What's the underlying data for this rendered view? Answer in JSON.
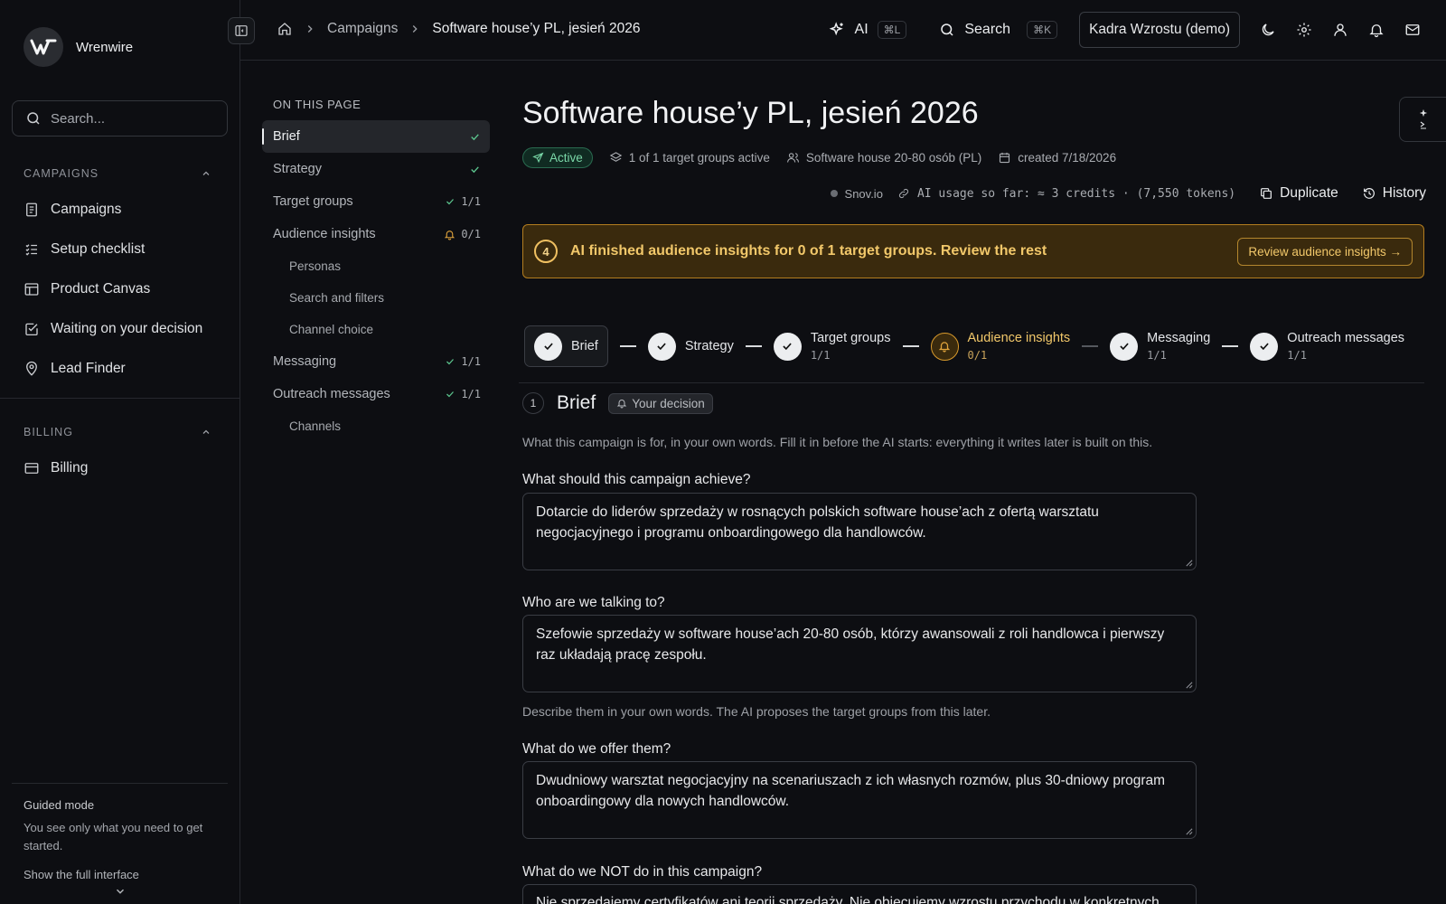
{
  "sidebar": {
    "brand": "Wrenwire",
    "search_placeholder": "Search...",
    "campaigns_header": "CAMPAIGNS",
    "items": [
      {
        "label": "Campaigns",
        "icon": "document-icon"
      },
      {
        "label": "Setup checklist",
        "icon": "checklist-icon"
      },
      {
        "label": "Product Canvas",
        "icon": "layout-icon"
      },
      {
        "label": "Waiting on your decision",
        "icon": "checkbox-icon"
      },
      {
        "label": "Lead Finder",
        "icon": "map-pin-icon"
      }
    ],
    "billing_header": "BILLING",
    "billing_item": "Billing",
    "guided_title": "Guided mode",
    "guided_desc": "You see only what you need to get started.",
    "guided_link": "Show the full interface"
  },
  "topbar": {
    "breadcrumb_campaigns": "Campaigns",
    "breadcrumb_current": "Software house’y PL, jesień 2026",
    "ai_label": "AI",
    "ai_shortcut": "⌘L",
    "search_label": "Search",
    "search_shortcut": "⌘K",
    "org": "Kadra Wzrostu (demo)"
  },
  "toc": {
    "header": "ON THIS PAGE",
    "items": [
      {
        "label": "Brief",
        "status": "check"
      },
      {
        "label": "Strategy",
        "status": "check"
      },
      {
        "label": "Target groups",
        "count": "1/1"
      },
      {
        "label": "Audience insights",
        "count": "0/1"
      },
      {
        "label": "Personas"
      },
      {
        "label": "Search and filters"
      },
      {
        "label": "Channel choice"
      },
      {
        "label": "Messaging",
        "count": "1/1"
      },
      {
        "label": "Outreach messages",
        "count": "1/1"
      },
      {
        "label": "Channels"
      }
    ]
  },
  "campaign": {
    "title": "Software house’y PL, jesień 2026",
    "status": "Active",
    "groups_active": "1 of 1 target groups active",
    "audience": "Software house 20-80 osób (PL)",
    "created": "created 7/18/2026",
    "provider": "Snov.io",
    "usage": "AI usage so far: ≈ 3 credits · (7,550 tokens)",
    "duplicate_label": "Duplicate",
    "history_label": "History"
  },
  "banner": {
    "number": "4",
    "message": "AI finished audience insights for 0 of 1 target groups. Review the rest",
    "button": "Review audience insights →"
  },
  "stepper": [
    {
      "label": "Brief"
    },
    {
      "label": "Strategy"
    },
    {
      "label": "Target groups",
      "count": "1/1"
    },
    {
      "label": "Audience insights",
      "count": "0/1"
    },
    {
      "label": "Messaging",
      "count": "1/1"
    },
    {
      "label": "Outreach messages",
      "count": "1/1"
    }
  ],
  "brief": {
    "number": "1",
    "title": "Brief",
    "decision_badge": "Your decision",
    "description": "What this campaign is for, in your own words. Fill it in before the AI starts: everything it writes later is built on this.",
    "q1_label": "What should this campaign achieve?",
    "q1_value": "Dotarcie do liderów sprzedaży w rosnących polskich software house’ach z ofertą warsztatu negocjacyjnego i programu onboardingowego dla handlowców.",
    "q2_label": "Who are we talking to?",
    "q2_value": "Szefowie sprzedaży w software house’ach 20-80 osób, którzy awansowali z roli handlowca i pierwszy raz układają pracę zespołu.",
    "q2_help": "Describe them in your own words. The AI proposes the target groups from this later.",
    "q3_label": "What do we offer them?",
    "q3_value": "Dwudniowy warsztat negocjacyjny na scenariuszach z ich własnych rozmów, plus 30-dniowy program onboardingowy dla nowych handlowców.",
    "q4_label": "What do we NOT do in this campaign?",
    "q4_value": "Nie sprzedajemy certyfikatów ani teorii sprzedaży. Nie obiecujemy wzrostu przychodu w konkretnych"
  },
  "colors": {
    "background": "#0d0e12",
    "accent_warning": "#f2c86a",
    "success": "#7ad8a8"
  }
}
